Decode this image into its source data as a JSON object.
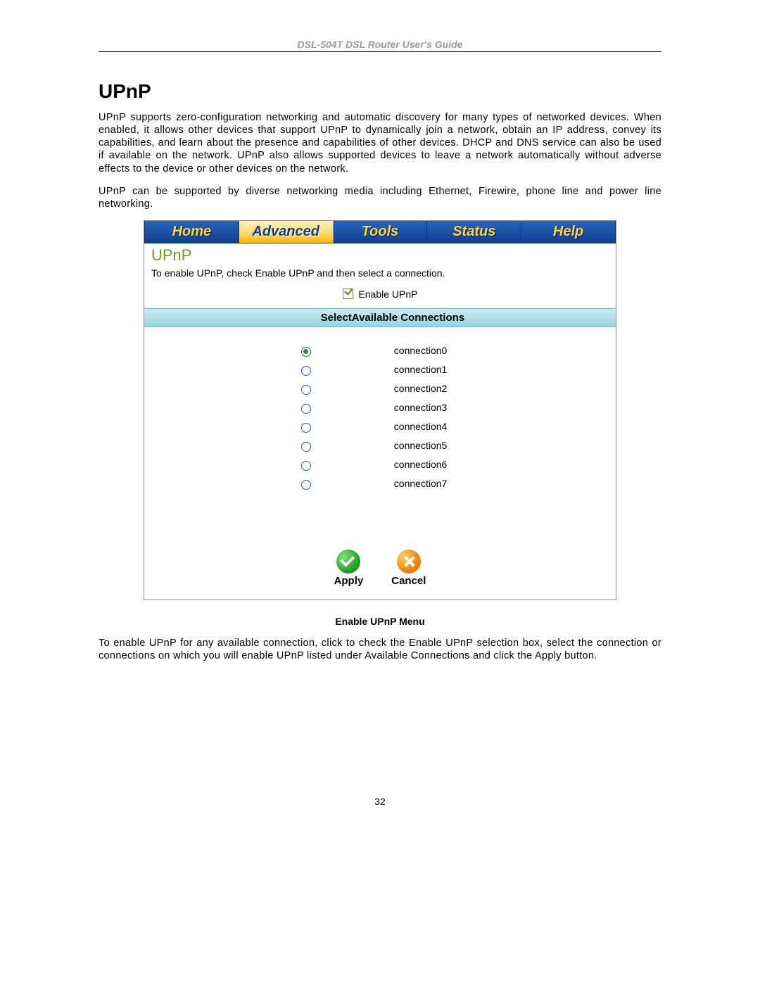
{
  "doc_header": "DSL-504T DSL Router User's Guide",
  "section_title": "UPnP",
  "para1": "UPnP supports zero-configuration networking and automatic discovery for many types of networked devices. When enabled, it allows other devices that support UPnP to dynamically join a network, obtain an IP address, convey its capabilities, and learn about the presence and capabilities of other devices. DHCP and DNS service can also be used if available on the network. UPnP also allows supported devices to leave a network automatically without adverse effects to the device or other devices on the network.",
  "para2": "UPnP can be supported by diverse networking media including Ethernet, Firewire, phone line and power line networking.",
  "tabs": {
    "home": "Home",
    "advanced": "Advanced",
    "tools": "Tools",
    "status": "Status",
    "help": "Help"
  },
  "panel": {
    "title": "UPnP",
    "subtitle": "To enable UPnP, check Enable UPnP and then select a connection.",
    "enable_label": "Enable UPnP",
    "col_select": "Select",
    "col_avail": "Available Connections",
    "connections": [
      "connection0",
      "connection1",
      "connection2",
      "connection3",
      "connection4",
      "connection5",
      "connection6",
      "connection7"
    ],
    "selected_index": 0,
    "apply_label": "Apply",
    "cancel_label": "Cancel"
  },
  "caption": "Enable UPnP Menu",
  "para3": "To enable UPnP for any available connection, click to check the Enable UPnP selection box, select the connection or connections on which you will enable UPnP listed under Available Connections and click the Apply button.",
  "page_number": "32"
}
